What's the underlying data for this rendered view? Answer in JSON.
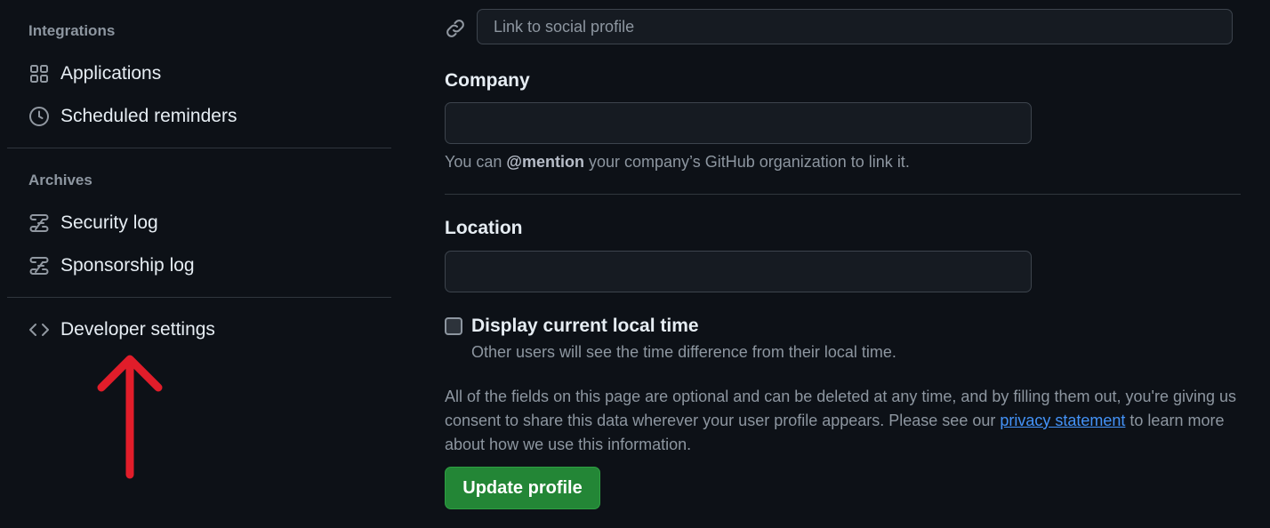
{
  "sidebar": {
    "integrations_heading": "Integrations",
    "integrations": [
      {
        "label": "Applications",
        "icon": "apps-grid-icon"
      },
      {
        "label": "Scheduled reminders",
        "icon": "clock-icon"
      }
    ],
    "archives_heading": "Archives",
    "archives": [
      {
        "label": "Security log",
        "icon": "log-icon"
      },
      {
        "label": "Sponsorship log",
        "icon": "log-icon"
      }
    ],
    "developer_settings": {
      "label": "Developer settings",
      "icon": "code-icon"
    }
  },
  "annotation": {
    "arrow_color": "#e11d2a",
    "direction": "up"
  },
  "form": {
    "social_link": {
      "placeholder": "Link to social profile",
      "value": "",
      "icon": "link-icon"
    },
    "company": {
      "label": "Company",
      "value": "",
      "hint_prefix": "You can ",
      "hint_mention": "@mention",
      "hint_suffix": " your company’s GitHub organization to link it."
    },
    "location": {
      "label": "Location",
      "value": ""
    },
    "local_time": {
      "label": "Display current local time",
      "hint": "Other users will see the time difference from their local time.",
      "checked": false
    },
    "disclaimer": {
      "before": "All of the fields on this page are optional and can be deleted at any time, and by filling them out, you're giving us consent to share this data wherever your user profile appears. Please see our ",
      "link": "privacy statement",
      "after": " to learn more about how we use this information."
    },
    "update_button": "Update profile"
  },
  "colors": {
    "background": "#0d1117",
    "input_background": "#161b22",
    "border": "#30363d",
    "muted_text": "#8d96a0",
    "link": "#4493f8",
    "primary_button": "#238636"
  }
}
